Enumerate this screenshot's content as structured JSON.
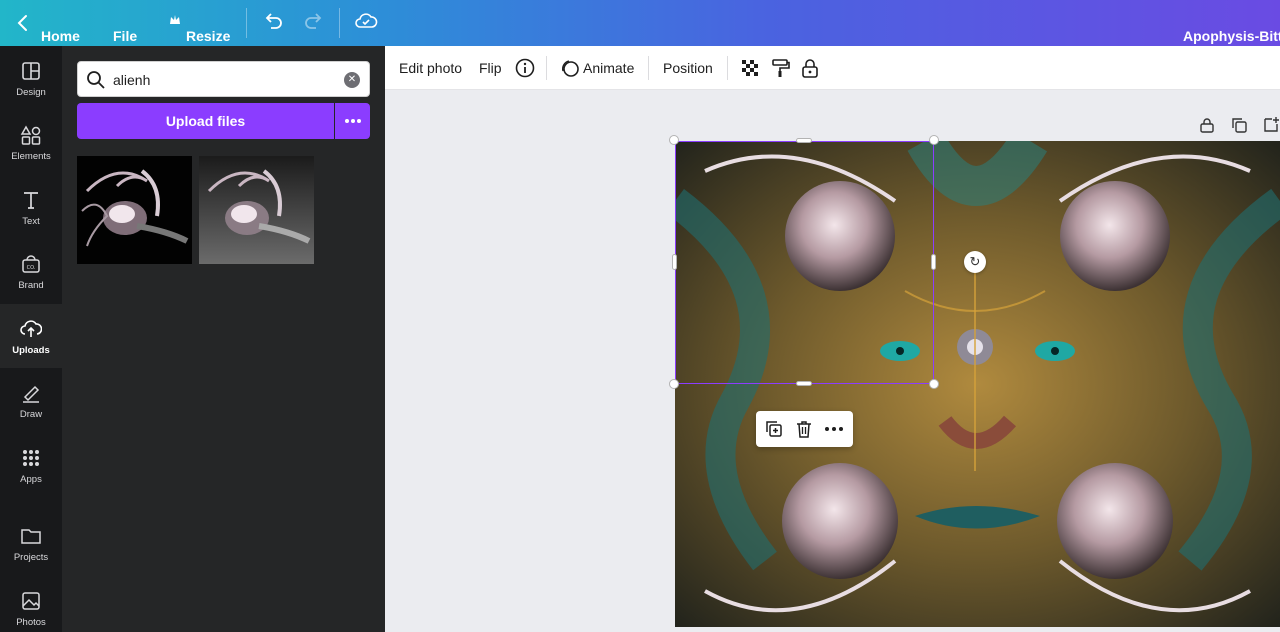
{
  "topbar": {
    "home_label": "Home",
    "file_label": "File",
    "resize_label": "Resize",
    "document_title": "Apophysis-Bitte"
  },
  "rail": {
    "items": [
      {
        "label": "Design",
        "icon": "layout-icon"
      },
      {
        "label": "Elements",
        "icon": "shapes-icon"
      },
      {
        "label": "Text",
        "icon": "text-icon"
      },
      {
        "label": "Brand",
        "icon": "brand-icon"
      },
      {
        "label": "Uploads",
        "icon": "cloud-upload-icon",
        "active": true
      },
      {
        "label": "Draw",
        "icon": "pen-icon"
      },
      {
        "label": "Apps",
        "icon": "grid-icon"
      },
      {
        "label": "Projects",
        "icon": "folder-icon"
      },
      {
        "label": "Photos",
        "icon": "image-icon"
      }
    ]
  },
  "panel": {
    "search_value": "alienh",
    "upload_label": "Upload files"
  },
  "context_toolbar": {
    "edit_photo": "Edit photo",
    "flip": "Flip",
    "animate": "Animate",
    "position": "Position"
  },
  "colors": {
    "accent": "#8b3dff",
    "rail_bg": "#18191b",
    "panel_bg": "#252627",
    "canvas_bg": "#ebecf0"
  }
}
